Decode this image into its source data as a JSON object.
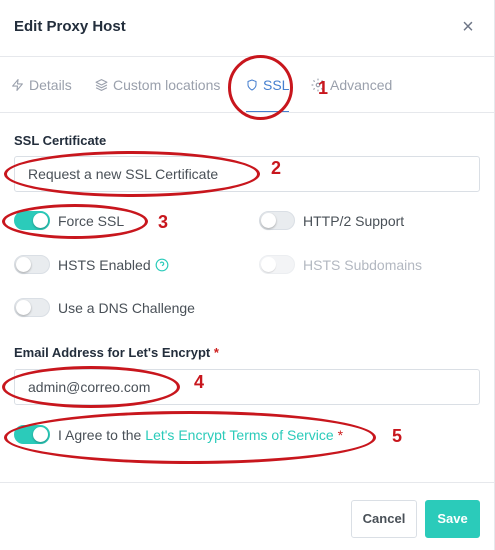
{
  "modal": {
    "title": "Edit Proxy Host",
    "close_glyph": "×"
  },
  "tabs": [
    {
      "label": "Details",
      "icon": "zap-icon",
      "active": false
    },
    {
      "label": "Custom locations",
      "icon": "layers-icon",
      "active": false
    },
    {
      "label": "SSL",
      "icon": "shield-icon",
      "active": true
    },
    {
      "label": "Advanced",
      "icon": "gear-icon",
      "active": false
    }
  ],
  "ssl": {
    "certificate_label": "SSL Certificate",
    "certificate_value": "Request a new SSL Certificate",
    "force_ssl": {
      "label": "Force SSL",
      "on": true
    },
    "http2": {
      "label": "HTTP/2 Support",
      "on": false
    },
    "hsts_enabled": {
      "label": "HSTS Enabled",
      "on": false
    },
    "hsts_subdomains": {
      "label": "HSTS Subdomains",
      "on": false,
      "disabled": true
    },
    "dns_challenge": {
      "label": "Use a DNS Challenge",
      "on": false
    },
    "email_label": "Email Address for Let's Encrypt",
    "required_mark": "*",
    "email_value": "admin@correo.com",
    "agree": {
      "prefix": "I Agree to the",
      "link": "Let's Encrypt Terms of Service",
      "required": "*",
      "on": true
    }
  },
  "footer": {
    "cancel_label": "Cancel",
    "save_label": "Save"
  },
  "annotations": [
    "1",
    "2",
    "3",
    "4",
    "5"
  ],
  "colors": {
    "accent": "#2bcbba",
    "active_tab": "#467fcf",
    "annotation_red": "#c8161d",
    "required": "#cd201f"
  }
}
